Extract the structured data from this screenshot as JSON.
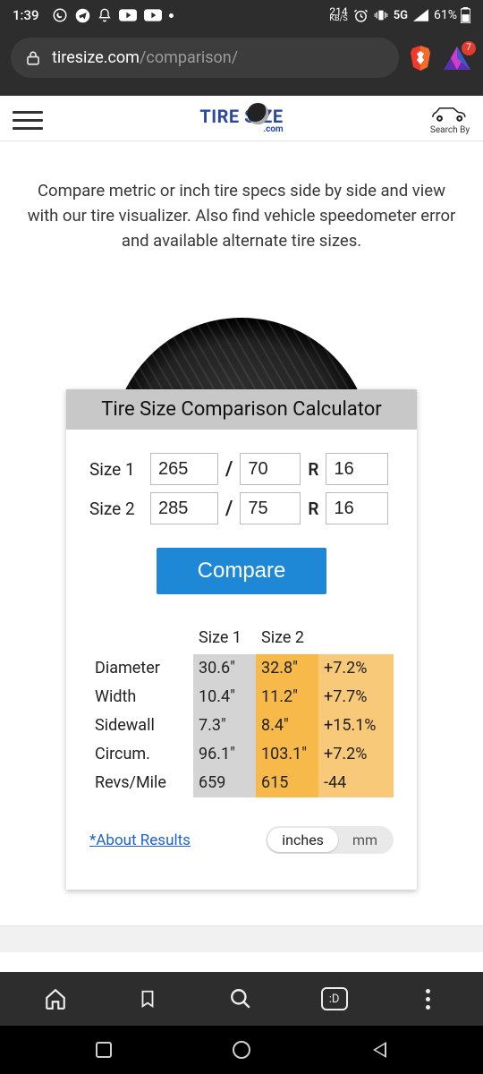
{
  "status": {
    "time": "1:39",
    "net_speed_num": "214",
    "net_speed_unit": "KB/S",
    "network": "5G",
    "battery_pct": "61%"
  },
  "browser": {
    "url_host": "tiresize.com",
    "url_path": "/comparison/",
    "notif_count": "7"
  },
  "header": {
    "logo_main": "TIRE SIZE",
    "logo_sub": ".com",
    "search_by": "Search By"
  },
  "intro": "Compare metric or inch tire specs side by side and view with our tire visualizer. Also find vehicle speedometer error and available alternate tire sizes.",
  "calc": {
    "title": "Tire Size Comparison Calculator",
    "size1_label": "Size 1",
    "size2_label": "Size 2",
    "size1": {
      "width": "265",
      "aspect": "70",
      "rim": "16"
    },
    "size2": {
      "width": "285",
      "aspect": "75",
      "rim": "16"
    },
    "slash": "/",
    "r": "R",
    "compare_btn": "Compare"
  },
  "results": {
    "col1": "Size 1",
    "col2": "Size 2",
    "rows": [
      {
        "metric": "Diameter",
        "v1": "30.6\"",
        "v2": "32.8\"",
        "d": "+7.2%"
      },
      {
        "metric": "Width",
        "v1": "10.4\"",
        "v2": "11.2\"",
        "d": "+7.7%"
      },
      {
        "metric": "Sidewall",
        "v1": "7.3\"",
        "v2": "8.4\"",
        "d": "+15.1%"
      },
      {
        "metric": "Circum.",
        "v1": "96.1\"",
        "v2": "103.1\"",
        "d": "+7.2%"
      },
      {
        "metric": "Revs/Mile",
        "v1": "659",
        "v2": "615",
        "d": "-44"
      }
    ],
    "about": "*About Results",
    "unit_in": "inches",
    "unit_mm": "mm"
  },
  "bottom": {
    "tab_face": ":D"
  }
}
